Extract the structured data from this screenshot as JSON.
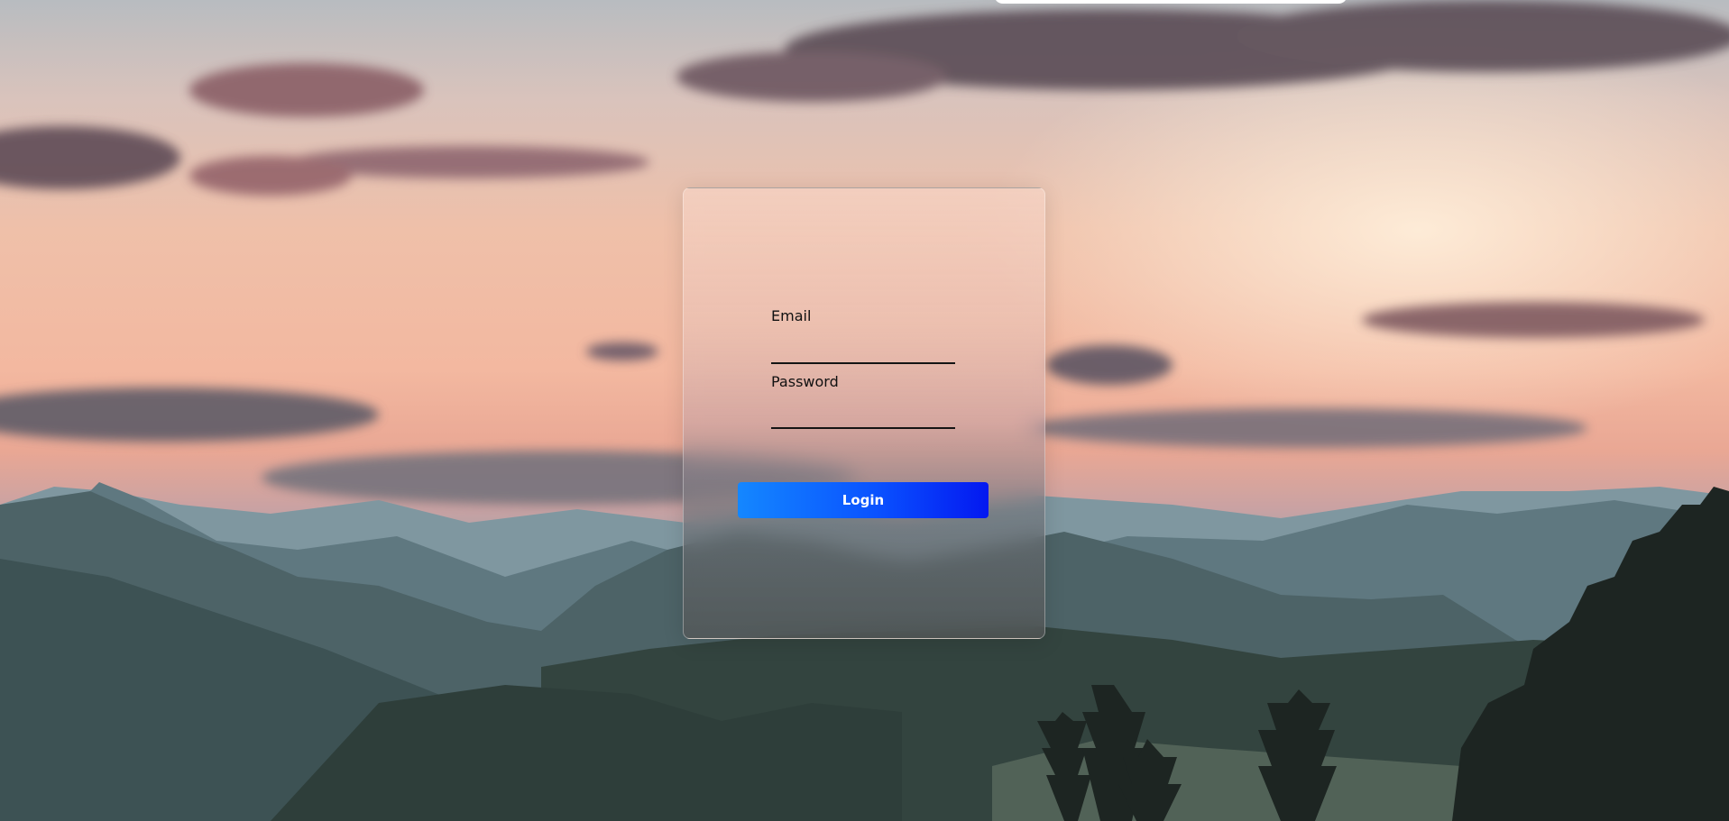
{
  "form": {
    "email_label": "Email",
    "email_value": "",
    "password_label": "Password",
    "password_value": "",
    "login_label": "Login"
  },
  "colors": {
    "button_start": "#1487ff",
    "button_end": "#0418f0",
    "button_text": "#ffffff",
    "label_text": "#111111"
  }
}
